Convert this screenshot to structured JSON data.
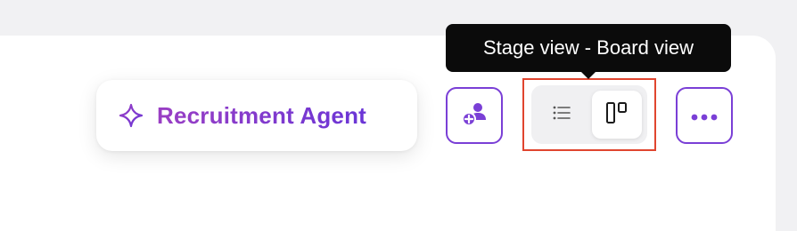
{
  "agent_button": {
    "label": "Recruitment Agent",
    "icon": "sparkle-icon"
  },
  "add_user_button": {
    "icon": "add-user-icon"
  },
  "view_toggle": {
    "options": [
      {
        "id": "list",
        "icon": "list-icon",
        "selected": false
      },
      {
        "id": "board",
        "icon": "board-icon",
        "selected": true
      }
    ]
  },
  "more_button": {
    "icon": "more-icon"
  },
  "tooltip": {
    "text": "Stage view - Board view"
  },
  "colors": {
    "accent": "#7a3fd6",
    "gradient_start": "#9a3fc4",
    "gradient_end": "#6a35d6",
    "highlight_border": "#e0452f",
    "tooltip_bg": "#0b0b0b"
  }
}
